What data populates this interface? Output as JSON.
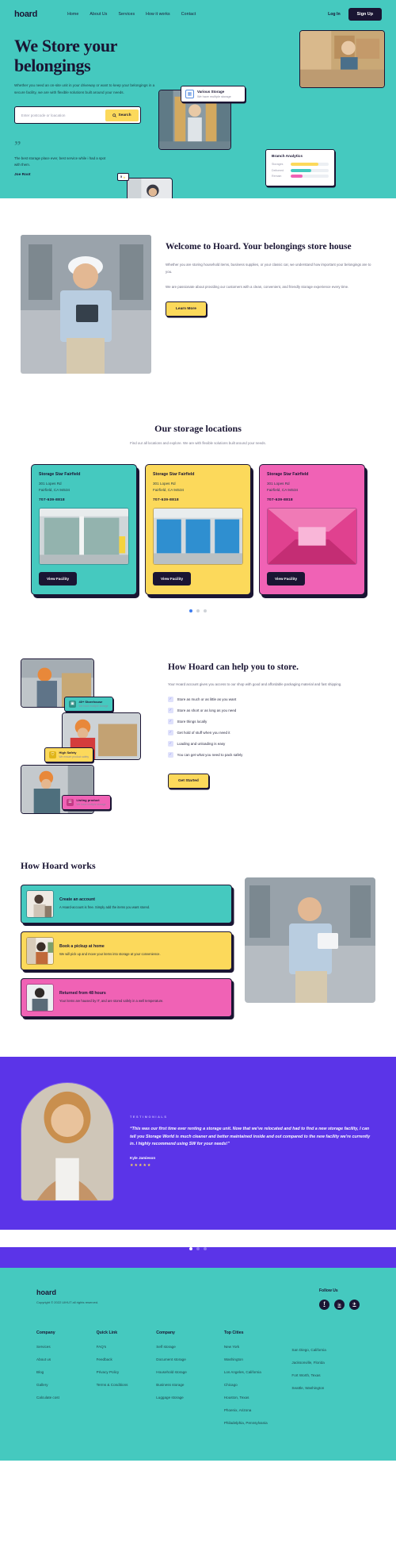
{
  "brand": {
    "name": "hoard",
    "teal": "#45c9bf",
    "yellow": "#fcd95b",
    "pink": "#f062b5",
    "ink": "#1a1533",
    "purple": "#5b34e8"
  },
  "nav": {
    "logo": "hoard",
    "links": [
      {
        "label": "Home"
      },
      {
        "label": "About Us"
      },
      {
        "label": "Services"
      },
      {
        "label": "How it works"
      },
      {
        "label": "Contact"
      }
    ],
    "login": "Log In",
    "signup": "Sign Up"
  },
  "hero": {
    "title": "We Store your belongings",
    "subtitle": "Whether you need an on-site unit in your driveway or want to keep your belongings in a secure facility, we are with flexible solutions built around your needs.",
    "search_placeholder": "Enter postcode or loacation",
    "search_value": "",
    "search_button": "Search",
    "quote_mark": "”",
    "quote_text": "The best storage place ever, best service while i had a spot with them.",
    "quote_author": "Joe Root",
    "rating_badge": "5",
    "card_various": {
      "title": "Various Storage",
      "subtitle": "We have multiple storage",
      "icon": "grid-icon"
    },
    "card_analytics": {
      "title": "Branch Analytics",
      "rows": [
        {
          "label": "Storages",
          "pct": 72,
          "color": "#fcd95b"
        },
        {
          "label": "Delivered",
          "pct": 55,
          "color": "#45c9bf"
        },
        {
          "label": "Remain",
          "pct": 32,
          "color": "#f062b5"
        }
      ]
    }
  },
  "welcome": {
    "title": "Welcome to Hoard. Your belongings store house",
    "paragraph1": "Whether you are storing household items, business supplies, or your classic car, we understand how important your belongings are to you.",
    "paragraph2": "We are passionate about providing our customers with a clean, convenient, and friendly storage experience every time.",
    "button": "Learn More"
  },
  "locations": {
    "title": "Our storage locations",
    "subtitle": "Find our all locations and explore. We are with flexible solutions built around your needs.",
    "cards": [
      {
        "name": "Storage Star Fairfield",
        "address_line1": "301 Lopes Rd",
        "address_line2": "Fairfield, CA 94534",
        "phone": "707-639-8818",
        "button": "View Facility",
        "theme": "teal"
      },
      {
        "name": "Storage Star Fairfield",
        "address_line1": "301 Lopes Rd",
        "address_line2": "Fairfield, CA 94534",
        "phone": "707-639-8818",
        "button": "View Facility",
        "theme": "yellow"
      },
      {
        "name": "Storage Star Fairfield",
        "address_line1": "301 Lopes Rd",
        "address_line2": "Fairfield, CA 94534",
        "phone": "707-639-8818",
        "button": "View Facility",
        "theme": "pink"
      }
    ]
  },
  "help": {
    "title": "How Hoard can help you to store.",
    "paragraph": "Your Hoard account gives you access to our shop with good and affordable packaging material and fast shipping.",
    "checks": [
      {
        "label": "Store as much or as little as you want"
      },
      {
        "label": "Store as short or as long as you need"
      },
      {
        "label": "Store things locally"
      },
      {
        "label": "Get hold of stuff when you need it"
      },
      {
        "label": "Loading and unloading is easy"
      },
      {
        "label": "You can get what you need to pack safely"
      }
    ],
    "button": "Get Started",
    "tags": [
      {
        "title": "40+ Storehouse",
        "subtitle": "We have multiple storage",
        "icon": "box-icon",
        "theme": "teal"
      },
      {
        "title": "High Safety",
        "subtitle": "We ensure product safety",
        "icon": "shield-icon",
        "theme": "yellow"
      },
      {
        "title": "Listing product",
        "subtitle": "We have multiple storage",
        "icon": "list-icon",
        "theme": "pink"
      }
    ]
  },
  "works": {
    "title": "How Hoard works",
    "steps": [
      {
        "title": "Create an account",
        "desc": "A Hoard-account is free. Simply add the items you want stored.",
        "theme": "teal"
      },
      {
        "title": "Book a pickup at home",
        "desc": "We will pick up and move your items into storage at your convenience.",
        "theme": "yellow"
      },
      {
        "title": "Returned from 48 hours",
        "desc": "Your items are haused by IT, and are stored safely in a well temperature.",
        "theme": "pink"
      }
    ]
  },
  "testimonial": {
    "eyebrow": "TESTIMONIALS",
    "quote": "“This was our first time ever renting a storage unit. Now that we've relocated and had to find a new storage facility, I can tell you Storage World is much cleaner and better maintained inside and out compared to the new facility we're currently in. I highly recommend using SW for your needs!”",
    "author": "Kyle Jamieson",
    "stars": "★★★★★",
    "dots": 3,
    "active_dot": 0
  },
  "footer": {
    "logo": "hoard",
    "copyright": "Copyright © 2022 UIHUT all rights reserved.",
    "follow_title": "Follow Us",
    "socials": [
      {
        "name": "facebook-icon",
        "glyph": "f"
      },
      {
        "name": "linkedin-icon",
        "glyph": "in"
      },
      {
        "name": "twitter-icon",
        "glyph": "✈"
      }
    ],
    "columns": [
      {
        "heading": "Company",
        "links": [
          "Services",
          "About us",
          "Blog",
          "Gallery",
          "Calculate cost"
        ]
      },
      {
        "heading": "Quick Link",
        "links": [
          "FAQ's",
          "Feedback",
          "Privacy Policy",
          "Terms & Conditions"
        ]
      },
      {
        "heading": "Company",
        "links": [
          "Self storage",
          "Document storage",
          "Household storage",
          "Business storage",
          "Luggage storage"
        ]
      },
      {
        "heading": "Top Cities",
        "links": [
          "New York",
          "Washington",
          "Los Angeles, California",
          "Chicago",
          "Houston, Texas",
          "Phoenix, Arizona",
          "Philadelphia, Pennsylvania"
        ]
      },
      {
        "heading": "",
        "links": [
          "San Diego, California",
          "Jacksonville, Florida",
          "Fort Worth, Texas",
          "Seattle, Washington"
        ]
      }
    ]
  }
}
